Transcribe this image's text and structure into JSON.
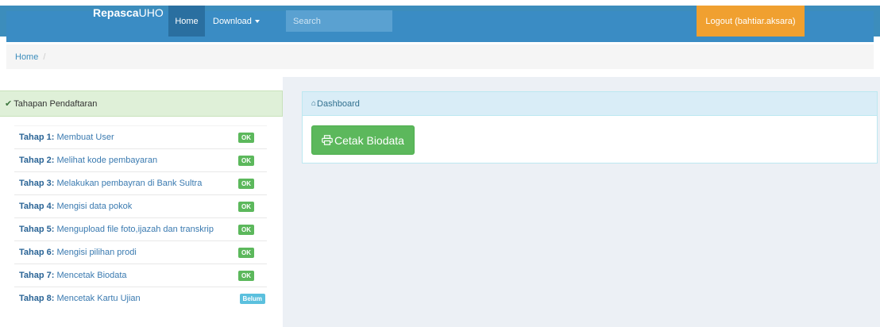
{
  "navbar": {
    "brand_bold": "Repasca",
    "brand_rest": "UHO",
    "home_label": "Home",
    "download_label": "Download",
    "search_placeholder": "Search",
    "logout_label": "Logout (bahtiar.aksara)",
    "colors": {
      "bar": "#3a8cc4",
      "active": "#2a6fa0",
      "logout": "#f0a030"
    }
  },
  "breadcrumb": {
    "items": [
      "Home"
    ],
    "separator": "/"
  },
  "left_panel": {
    "title": "Tahapan Pendaftaran",
    "icon": "check-icon",
    "steps": [
      {
        "prefix": "Tahap 1:",
        "text": "Membuat User",
        "status": "OK"
      },
      {
        "prefix": "Tahap 2:",
        "text": "Melihat kode pembayaran",
        "status": "OK"
      },
      {
        "prefix": "Tahap 3:",
        "text": "Melakukan pembayran di Bank Sultra",
        "status": "OK"
      },
      {
        "prefix": "Tahap 4:",
        "text": "Mengisi data pokok",
        "status": "OK"
      },
      {
        "prefix": "Tahap 5:",
        "text": "Mengupload file foto,ijazah dan transkrip",
        "status": "OK"
      },
      {
        "prefix": "Tahap 6:",
        "text": "Mengisi pilihan prodi",
        "status": "OK"
      },
      {
        "prefix": "Tahap 7:",
        "text": "Mencetak Biodata",
        "status": "OK"
      },
      {
        "prefix": "Tahap 8:",
        "text": "Mencetak Kartu Ujian",
        "status": "Belum"
      }
    ]
  },
  "dashboard": {
    "title": "Dashboard",
    "icon": "home-icon",
    "button_label": "Cetak Biodata",
    "button_icon": "print-icon"
  }
}
